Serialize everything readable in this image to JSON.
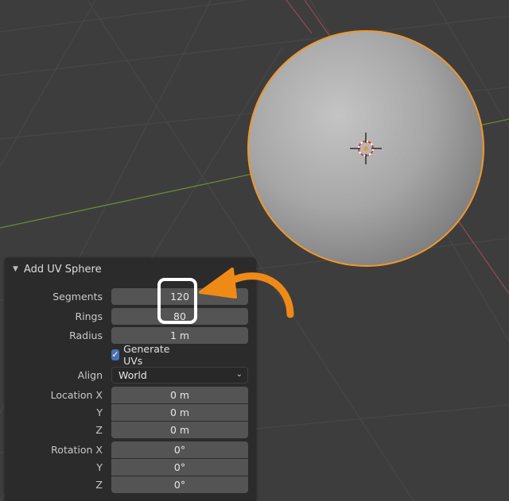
{
  "panel": {
    "title": "Add UV Sphere",
    "segments": {
      "label": "Segments",
      "value": "120"
    },
    "rings": {
      "label": "Rings",
      "value": "80"
    },
    "radius": {
      "label": "Radius",
      "value": "1 m"
    },
    "generate_uvs": {
      "label": "Generate UVs",
      "checked": true
    },
    "align": {
      "label": "Align",
      "value": "World"
    },
    "location": {
      "label_x": "Location X",
      "label_y": "Y",
      "label_z": "Z",
      "x": "0 m",
      "y": "0 m",
      "z": "0 m"
    },
    "rotation": {
      "label_x": "Rotation X",
      "label_y": "Y",
      "label_z": "Z",
      "x": "0°",
      "y": "0°",
      "z": "0°"
    }
  },
  "icons": {
    "collapse": "triangle-down-icon",
    "check": "checkmark-icon",
    "dropdown": "chevron-down-icon",
    "cursor": "3d-cursor-icon"
  },
  "colors": {
    "viewport_bg": "#3d3d3d",
    "grid": "#474747",
    "x_axis": "#8c4a52",
    "y_axis": "#6a8a3a",
    "selection_outline": "#f2972a",
    "annotation_orange": "#f08a17",
    "highlight": "#ffffff",
    "checkbox": "#4772b3"
  }
}
